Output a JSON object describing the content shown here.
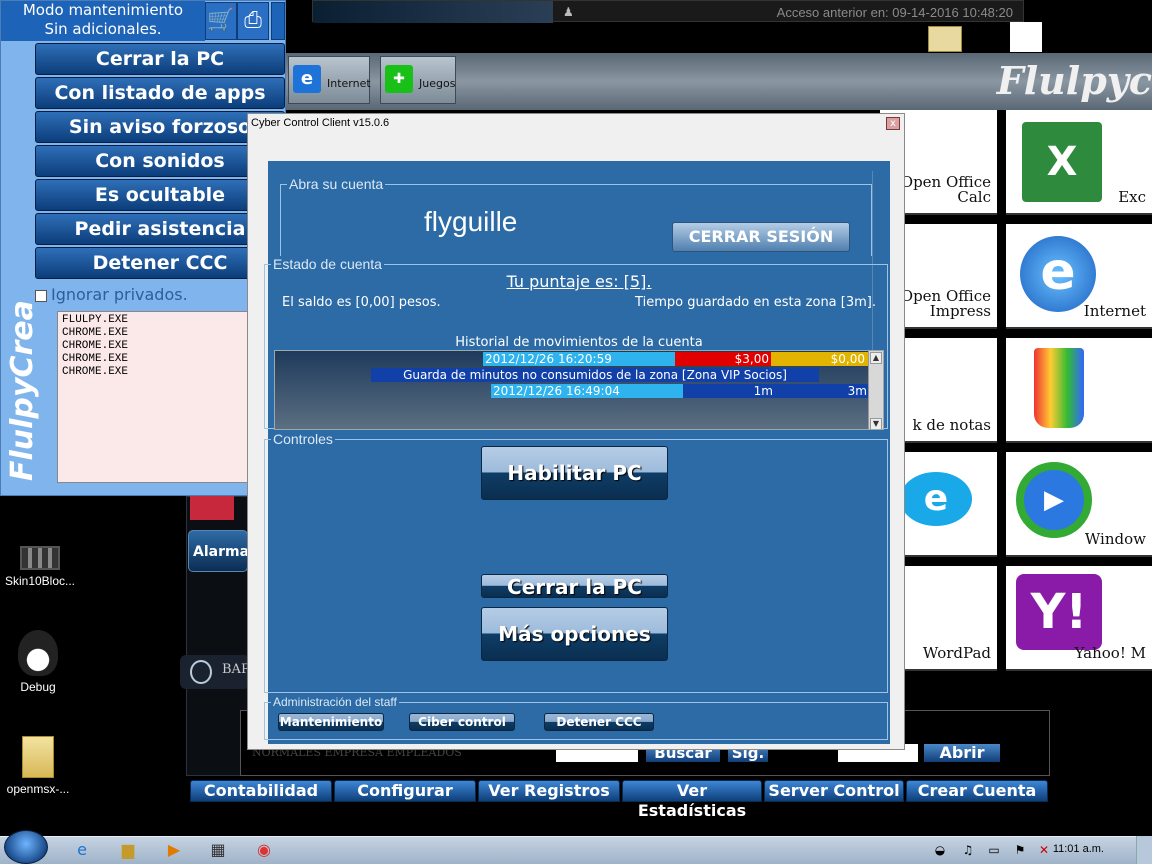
{
  "top_bar": {
    "last_access": "Acceso anterior en: 09-14-2016 10:48:20"
  },
  "app": {
    "logo": "Flulpyc",
    "tabs": [
      {
        "label": "Internet"
      },
      {
        "label": "Juegos"
      }
    ],
    "tiles": [
      {
        "label": "Open Office\nCalc"
      },
      {
        "label": "Exc"
      },
      {
        "label": "Open Office\nImpress"
      },
      {
        "label": "Internet"
      },
      {
        "label": "k de notas"
      },
      {
        "label": ""
      },
      {
        "label": ""
      },
      {
        "label": "Window"
      },
      {
        "label": "WordPad"
      },
      {
        "label": "Yahoo! M"
      }
    ],
    "side_items": {
      "alarm": "Alarma",
      "bar": "BAR"
    },
    "bottom_buttons": [
      "Contabilidad",
      "Configurar",
      "Ver Registros",
      "Ver Estadísticas",
      "Server Control",
      "Crear Cuenta"
    ],
    "hidden_partial": {
      "search": "Buscar",
      "sig": "Sig.",
      "open": "Abrir",
      "filters": "NORMALES   EMPRESA   EMPLEADOS"
    }
  },
  "left_panel": {
    "mode_title": "Modo mantenimiento",
    "mode_subtitle": "Sin adicionales.",
    "buttons": [
      "Cerrar la PC",
      "Con listado de apps",
      "Sin aviso forzoso",
      "Con sonidos",
      "Es ocultable",
      "Pedir asistencia",
      "Detener CCC"
    ],
    "ignore_private": "Ignorar privados.",
    "processes": [
      "FLULPY.EXE",
      "CHROME.EXE",
      "CHROME.EXE",
      "CHROME.EXE",
      "CHROME.EXE"
    ],
    "brand": "FlulpyCrea"
  },
  "desktop_icons": [
    {
      "label": "Skin10Bloc..."
    },
    {
      "label": "Debug"
    },
    {
      "label": "openmsx-..."
    }
  ],
  "dialog": {
    "title": "Cyber Control Client v15.0.6",
    "close": "x",
    "account_group": "Abra su cuenta",
    "username": "flyguille",
    "logout": "CERRAR SESIÓN",
    "status_group": "Estado de cuenta",
    "score": "Tu puntaje es: [5].",
    "balance": "El saldo es [0,00] pesos.",
    "saved_time": "Tiempo guardado en esta zona [3m].",
    "history_title": "Historial de movimientos de la cuenta",
    "history": {
      "row1": {
        "date": "2012/12/26 16:20:59",
        "amount": "$3,00",
        "balance": "$0,00"
      },
      "row2": {
        "text": "Guarda de minutos no consumidos de la zona [Zona VIP Socios]"
      },
      "row3": {
        "date": "2012/12/26 16:49:04",
        "minutes": "1m",
        "total": "3m"
      }
    },
    "controls_group": "Controles",
    "enable_pc": "Habilitar PC",
    "shutdown_pc": "Cerrar la PC",
    "more_options": "Más opciones",
    "staff_group": "Administración del staff",
    "staff_buttons": [
      "Mantenimiento",
      "Ciber control",
      "Detener CCC"
    ]
  },
  "taskbar": {
    "clock": "11:01 a.m."
  },
  "colors": {
    "panel_blue": "#7fb4ec",
    "dialog_blue": "#2d6ba6",
    "hist_cyan": "#2fb3ee",
    "hist_red": "#e00000",
    "hist_gold": "#e2b400",
    "hist_navy": "#1040a8"
  }
}
